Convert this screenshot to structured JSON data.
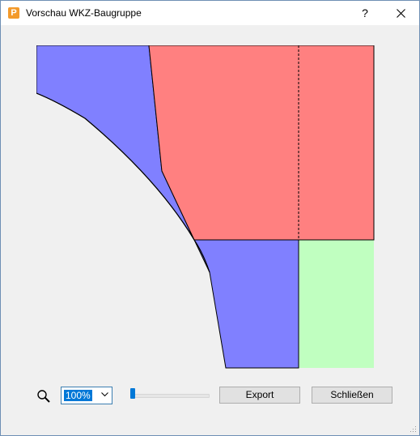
{
  "window": {
    "app_icon": "P",
    "title": "Vorschau WKZ-Baugruppe",
    "help_label": "?",
    "close_icon": "close-icon"
  },
  "preview": {
    "colors": {
      "red": "#ff8080",
      "blue": "#8080ff",
      "green": "#c0ffc0"
    }
  },
  "toolbar": {
    "zoom_icon": "magnifier-icon",
    "zoom_value": "100%",
    "zoom_slider_level": 0.0,
    "export_label": "Export",
    "close_label": "Schließen"
  },
  "accent_color": "#0078d7"
}
